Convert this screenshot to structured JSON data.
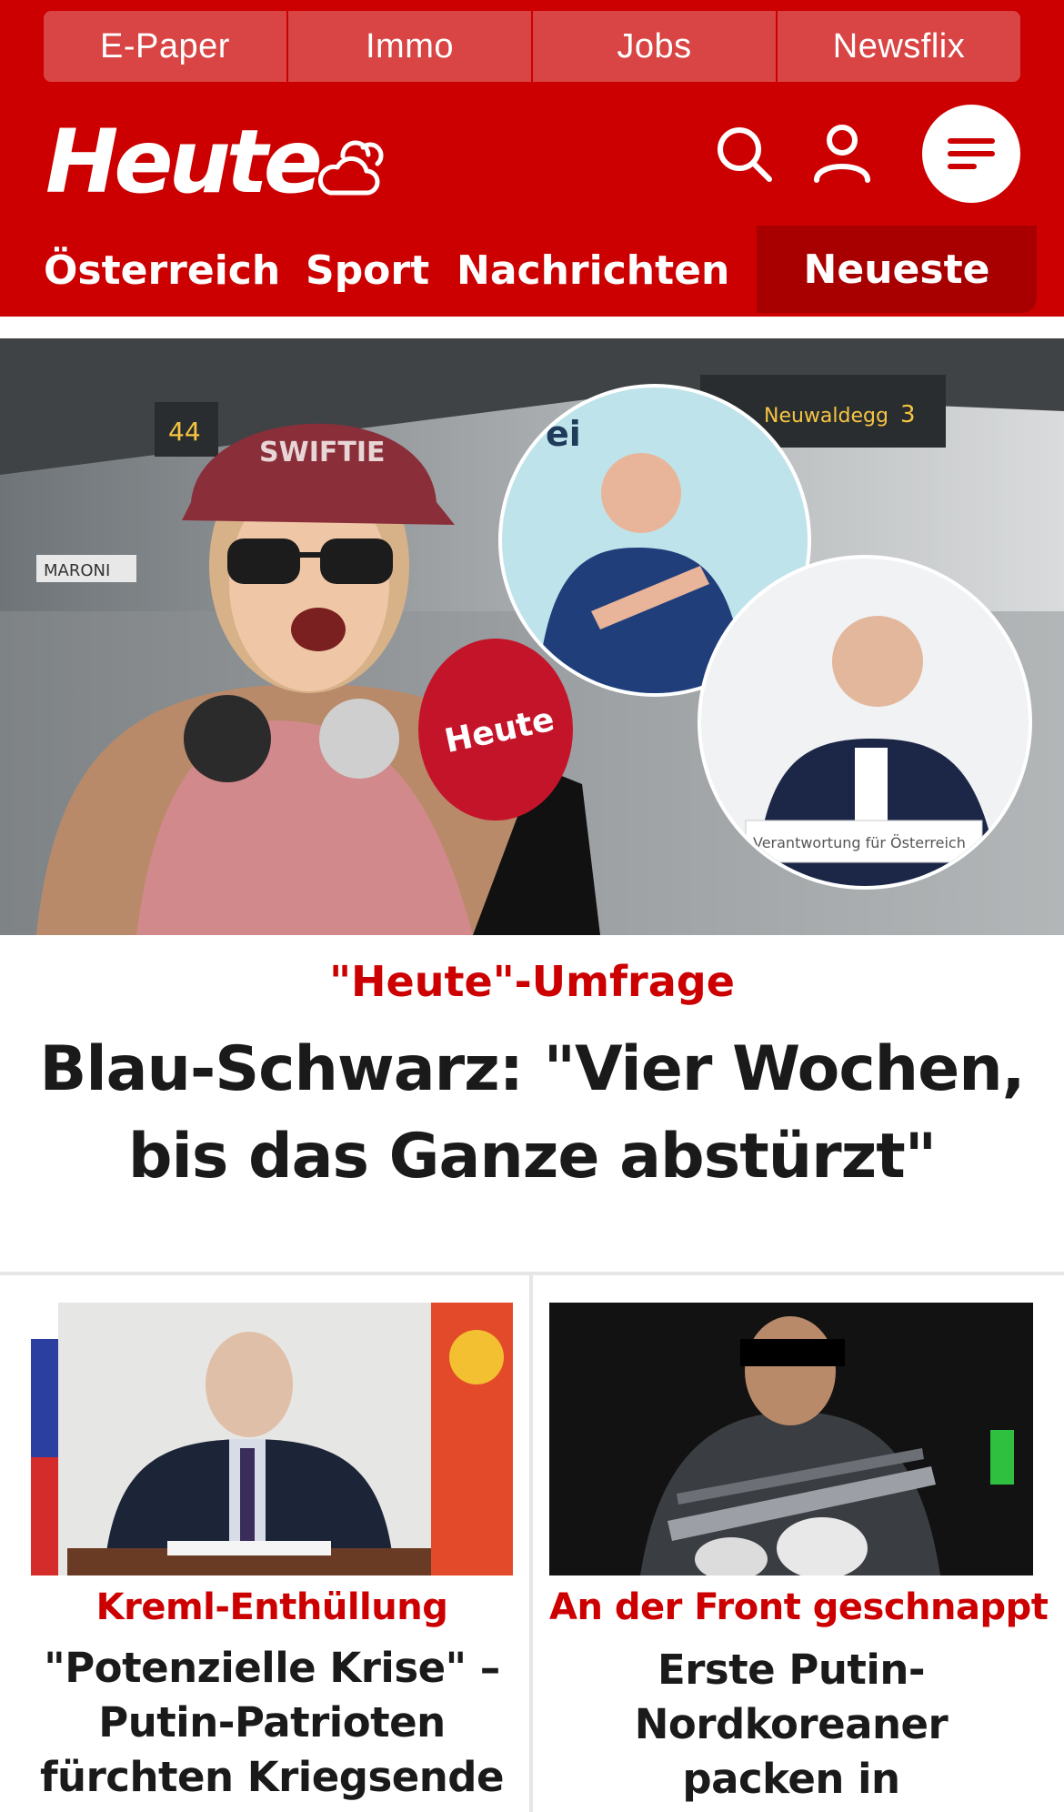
{
  "topnav": {
    "items": [
      {
        "label": "E-Paper"
      },
      {
        "label": "Immo"
      },
      {
        "label": "Jobs"
      },
      {
        "label": "Newsflix"
      }
    ]
  },
  "header": {
    "logo": "Heute",
    "icons": {
      "weather": "cloud-sun-icon",
      "search": "search-icon",
      "account": "user-icon",
      "menu": "hamburger-menu-icon"
    }
  },
  "secnav": {
    "items": [
      {
        "label": "Österreich"
      },
      {
        "label": "Sport"
      },
      {
        "label": "Nachrichten"
      }
    ],
    "active": {
      "label": "Neueste"
    }
  },
  "hero": {
    "kicker": "\"Heute\"-Umfrage",
    "title": "Blau-Schwarz: \"Vier Wochen, bis das Ganze abstürzt\"",
    "image": {
      "cap_text": "SWIFTIE",
      "mic_text": "Heute",
      "sign_text": "MARONI",
      "display_text": "Neuwaldegg",
      "display_number": "3",
      "display_left_number": "44",
      "backdrop_text": "ei",
      "lectern_text": "Verantwortung für Österreich"
    }
  },
  "teasers": [
    {
      "kicker": "Kreml-Enthüllung",
      "title": "\"Potenzielle Krise\" – Putin-Patrioten fürchten Kriegsende"
    },
    {
      "kicker": "An der Front geschnappt",
      "title": "Erste Putin-Nordkoreaner packen in Gefangenschaft aus"
    }
  ],
  "colors": {
    "brand_red": "#cc0000",
    "topnav_item": "#d94545",
    "active_tab": "#a80000",
    "headline": "#1a1a1a",
    "divider": "#e6e6e6"
  }
}
